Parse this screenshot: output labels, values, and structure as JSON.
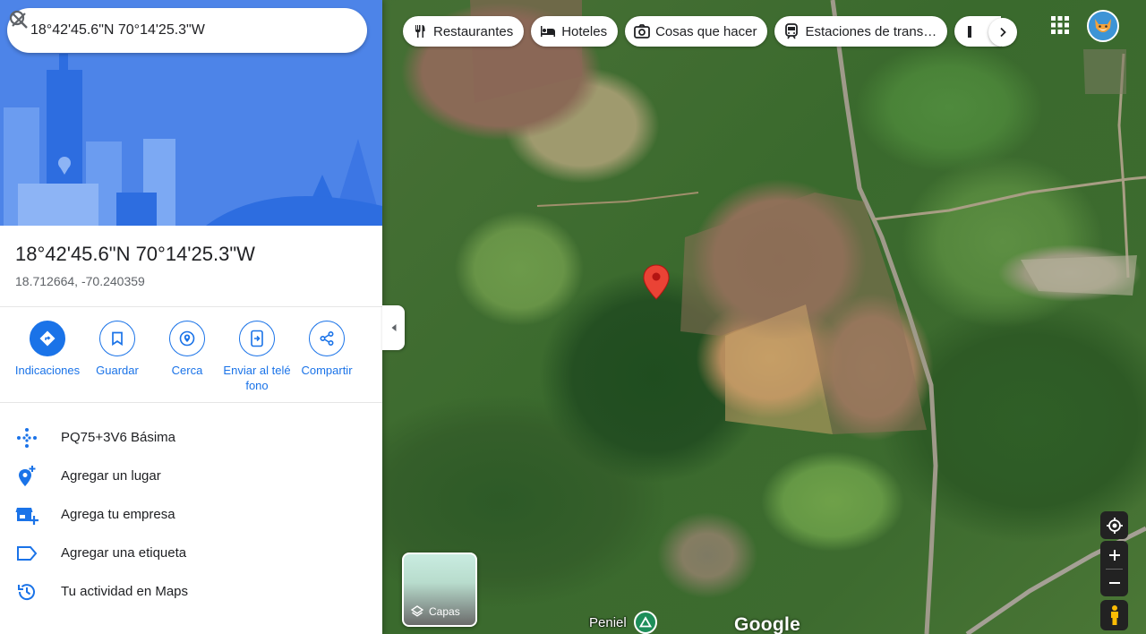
{
  "search": {
    "value": "18°42'45.6\"N 70°14'25.3\"W",
    "search_icon": "search-icon",
    "clear_icon": "close-icon"
  },
  "place": {
    "title": "18°42'45.6\"N 70°14'25.3\"W",
    "coords": "18.712664, -70.240359"
  },
  "actions": [
    {
      "label": "Indicaciones",
      "icon": "directions-icon",
      "primary": true
    },
    {
      "label": "Guardar",
      "icon": "bookmark-icon"
    },
    {
      "label": "Cerca",
      "icon": "nearby-icon"
    },
    {
      "label": "Enviar al teléfono",
      "icon": "send-to-phone-icon"
    },
    {
      "label": "Compartir",
      "icon": "share-icon"
    }
  ],
  "details": [
    {
      "label": "PQ75+3V6 Básima",
      "icon": "plus-code-icon"
    },
    {
      "label": "Agregar un lugar",
      "icon": "add-place-icon"
    },
    {
      "label": "Agrega tu empresa",
      "icon": "add-business-icon"
    },
    {
      "label": "Agregar una etiqueta",
      "icon": "label-icon"
    },
    {
      "label": "Tu actividad en Maps",
      "icon": "history-icon"
    }
  ],
  "chips": [
    {
      "label": "Restaurantes",
      "icon": "restaurant-icon"
    },
    {
      "label": "Hoteles",
      "icon": "hotel-icon"
    },
    {
      "label": "Cosas que hacer",
      "icon": "camera-icon"
    },
    {
      "label": "Estaciones de trans…",
      "icon": "transit-icon"
    }
  ],
  "layers": {
    "label": "Capas"
  },
  "poi": {
    "label": "Peniel"
  },
  "logo": "Google",
  "colors": {
    "accent": "#1a73e8",
    "pin": "#ea4335",
    "hero": "#4d84e8"
  }
}
